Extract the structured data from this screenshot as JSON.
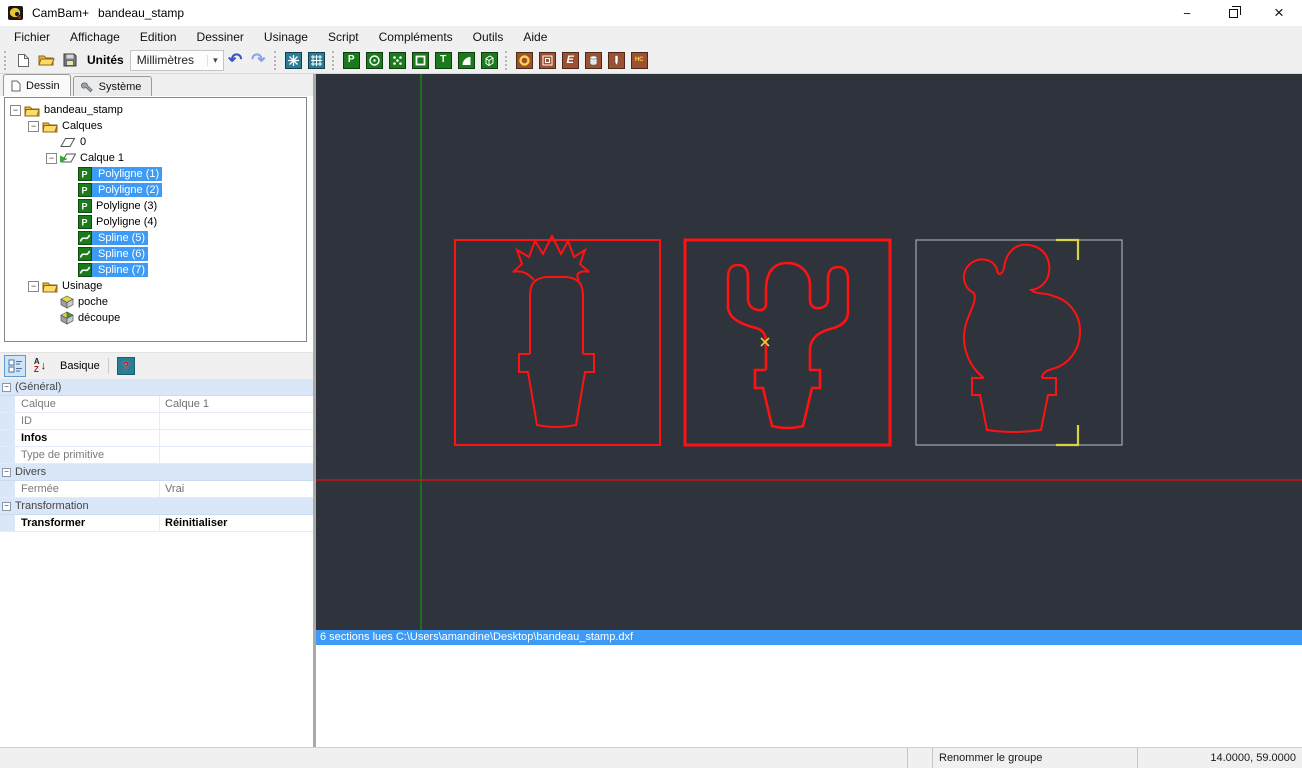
{
  "window": {
    "app_name": "CamBam+",
    "doc_name": "bandeau_stamp"
  },
  "menu": {
    "items": [
      "Fichier",
      "Affichage",
      "Edition",
      "Dessiner",
      "Usinage",
      "Script",
      "Compléments",
      "Outils",
      "Aide"
    ]
  },
  "toolbar": {
    "units_label": "Unités",
    "units_value": "Millimètres"
  },
  "tabs": {
    "drawing": "Dessin",
    "system": "Système"
  },
  "tree": {
    "items": [
      {
        "label": "bandeau_stamp"
      },
      {
        "label": "Calques"
      },
      {
        "label": "0"
      },
      {
        "label": "Calque 1"
      },
      {
        "label": "Polyligne (1)"
      },
      {
        "label": "Polyligne (2)"
      },
      {
        "label": "Polyligne (3)"
      },
      {
        "label": "Polyligne (4)"
      },
      {
        "label": "Spline (5)"
      },
      {
        "label": "Spline (6)"
      },
      {
        "label": "Spline (7)"
      },
      {
        "label": "Usinage"
      },
      {
        "label": "poche"
      },
      {
        "label": "découpe"
      }
    ]
  },
  "properties": {
    "view_label": "Basique",
    "rows": [
      {
        "label": "(Général)"
      },
      {
        "label": "Calque",
        "value": "Calque 1"
      },
      {
        "label": "ID",
        "value": ""
      },
      {
        "label": "Infos",
        "value": ""
      },
      {
        "label": "Type de primitive",
        "value": ""
      },
      {
        "label": "Divers"
      },
      {
        "label": "Fermée",
        "value": "Vrai"
      },
      {
        "label": "Transformation"
      },
      {
        "label": "Transformer",
        "value": "Réinitialiser"
      }
    ]
  },
  "canvas": {
    "message": "6 sections lues C:\\Users\\amandine\\Desktop\\bandeau_stamp.dxf"
  },
  "statusbar": {
    "action": "Renommer le groupe",
    "coordinates": "14.0000, 59.0000"
  },
  "icons": {
    "expander_collapse": "−",
    "dropdown_arrow": "▾",
    "undo": "↶",
    "redo": "↷",
    "polyline_glyph": "P",
    "text_glyph": "T",
    "engrave_glyph": "E",
    "heightcut_glyph": "HC",
    "sort_a": "A",
    "sort_z": "Z",
    "sort_arrow": "↓",
    "help_glyph": "?",
    "minimize_glyph": "−",
    "close_glyph": "×"
  },
  "colors": {
    "canvas_bg": "#2f333c",
    "shape_red": "#ff1212",
    "ghost_gray": "#9ba0a8",
    "axis_green": "#1c6e1c",
    "axis_red": "#c01818",
    "selection_blue": "#3d9bf5",
    "marker_yellow": "#d9d542"
  }
}
